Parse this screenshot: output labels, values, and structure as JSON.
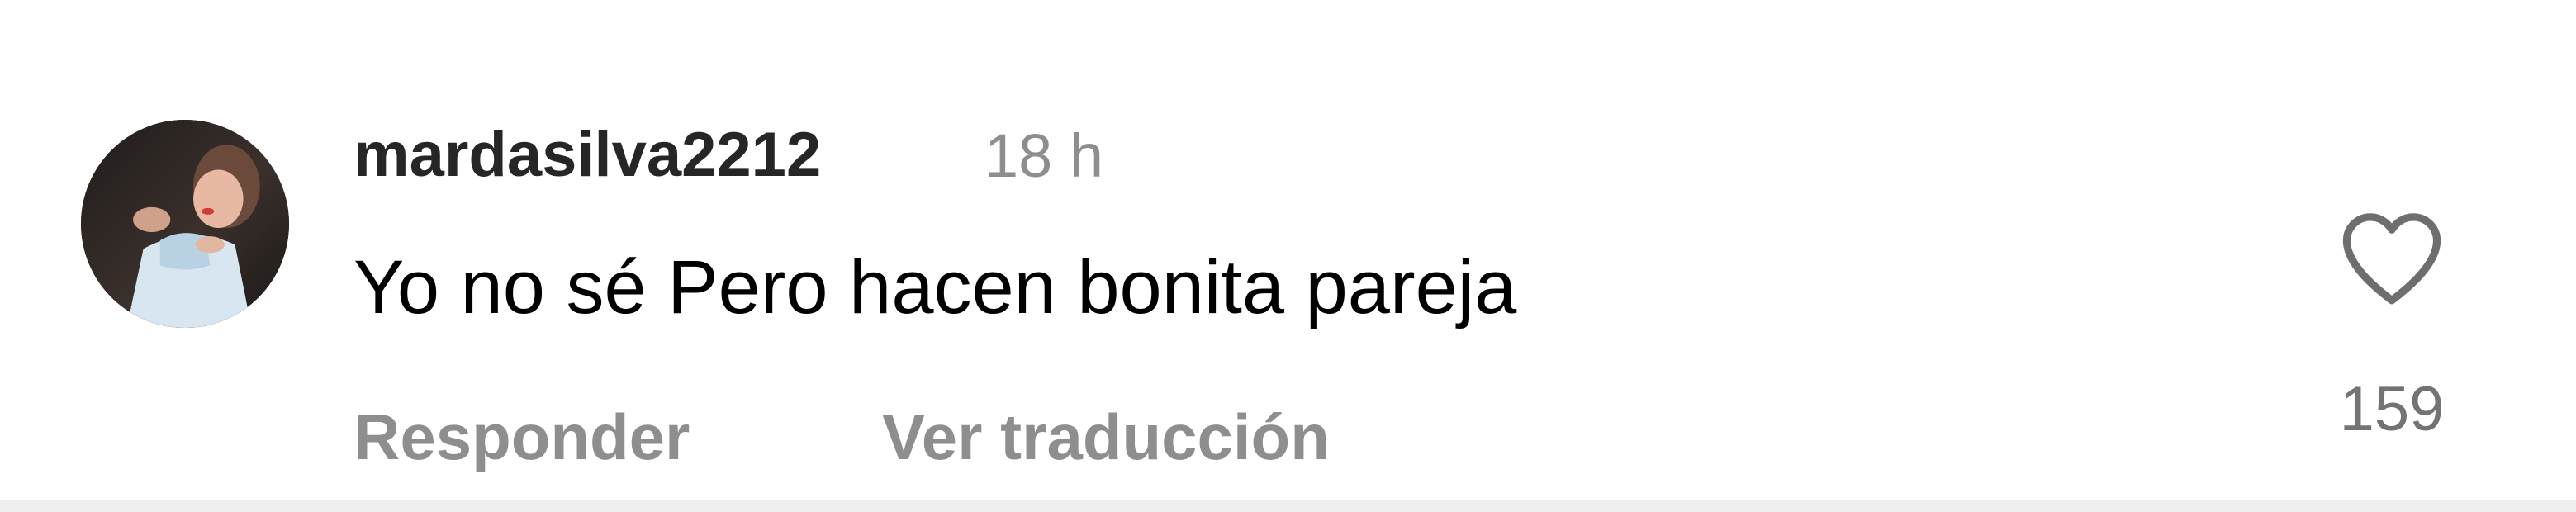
{
  "comment": {
    "username": "mardasilva2212",
    "time": "18 h",
    "text": "Yo no sé Pero hacen bonita pareja",
    "reply_label": "Responder",
    "translate_label": "Ver traducción",
    "like_count": "159",
    "avatar": "profile-photo",
    "like_icon": "heart-outline-icon"
  },
  "colors": {
    "username": "#262626",
    "secondary_text": "#8e8e8e",
    "body_text": "#000000",
    "like_icon": "#6e6e6e"
  }
}
